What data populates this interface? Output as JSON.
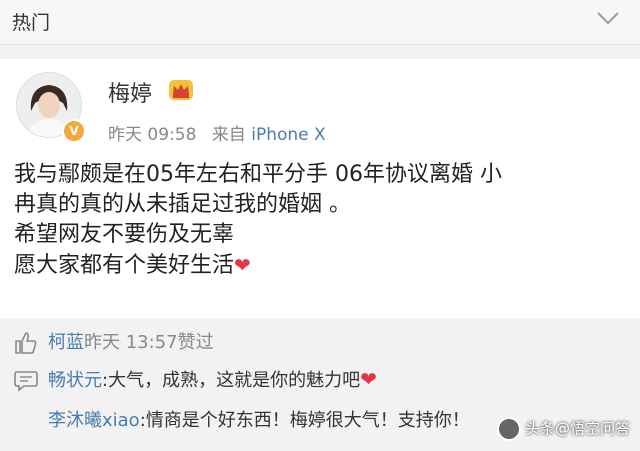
{
  "header": {
    "section_title": "热门",
    "chevron_icon": "chevron-down-icon"
  },
  "post": {
    "author": "梅婷",
    "badge_icon": "crown-icon",
    "verified_icon": "verified-v-icon",
    "time": "昨天 09:58",
    "source_prefix": "来自",
    "source_device": "iPhone X",
    "lines": [
      "我与鄢颇是在05年左右和平分手 06年协议离婚 小",
      "冉真的真的从未插足过我的婚姻 。",
      "希望网友不要伤及无辜",
      "愿大家都有个美好生活"
    ],
    "heart_emoji": "❤"
  },
  "likes": {
    "user": "柯蓝",
    "text": "昨天 13:57赞过"
  },
  "comments": [
    {
      "user": "畅状元",
      "text": ":大气，成熟，这就是你的魅力吧",
      "emoji": "❤"
    },
    {
      "user": "李沐曦xiao",
      "text": ":情商是个好东西！梅婷很大气！支持你！"
    }
  ],
  "watermark": {
    "text": "头条@悟空问答"
  },
  "colors": {
    "link": "#4a7cae",
    "meta": "#888888",
    "heart": "#e5354a",
    "badge": "#f3a83a"
  }
}
